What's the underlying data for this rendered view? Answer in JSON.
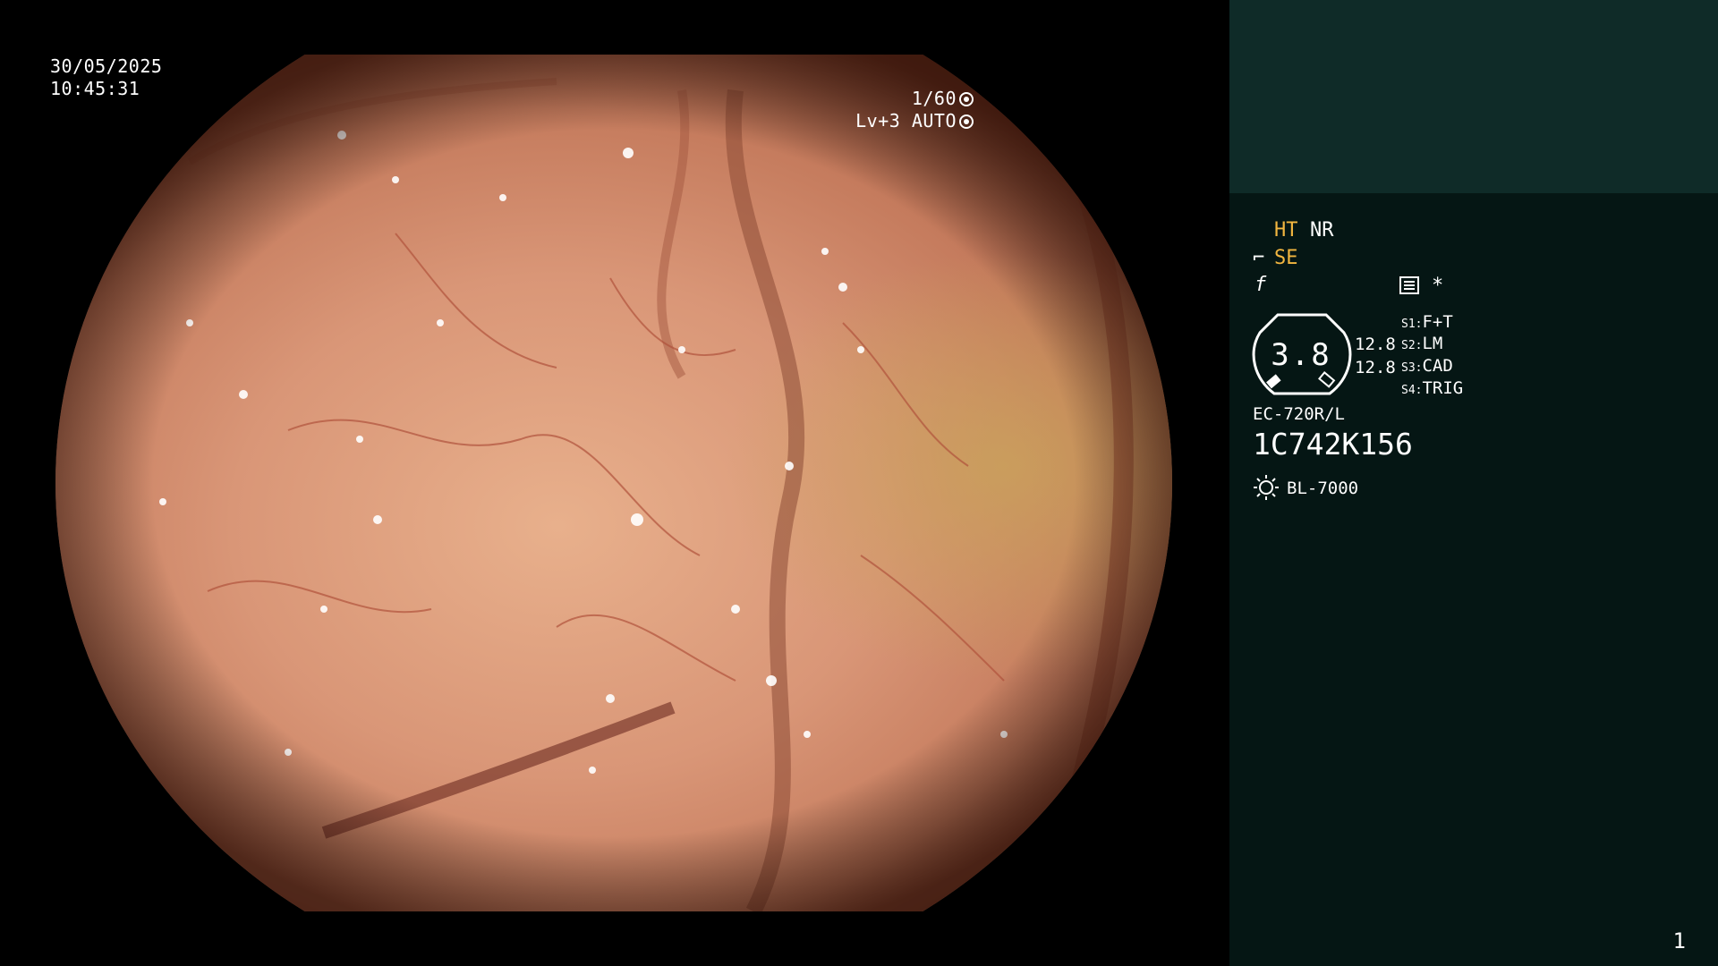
{
  "overlay": {
    "date": "30/05/2025",
    "time": "10:45:31",
    "shutter": "1/60",
    "level": "Lv+3 AUTO"
  },
  "panel": {
    "mode_ht": "HT",
    "mode_nr": "NR",
    "mode_se": "SE",
    "f_symbol": "f",
    "star": "*",
    "gauge_value": "3.8",
    "value_a": "12.8",
    "value_b": "12.8",
    "switches": [
      {
        "key": "S1:",
        "value": "F+T"
      },
      {
        "key": "S2:",
        "value": "LM"
      },
      {
        "key": "S3:",
        "value": "CAD"
      },
      {
        "key": "S4:",
        "value": "TRIG"
      }
    ],
    "scope_model": "EC-720R/L",
    "scope_serial": "1C742K156",
    "light_source": "BL-7000"
  },
  "footer": {
    "page_number": "1"
  },
  "colors": {
    "panel_bg": "#051614",
    "panel_top_bg": "#0f2b28",
    "accent_yellow": "#f2b640",
    "text": "#ffffff"
  },
  "icons": [
    "aperture-icon",
    "auto-iris-icon",
    "se-icon",
    "record-icon",
    "light-bulb-icon"
  ]
}
